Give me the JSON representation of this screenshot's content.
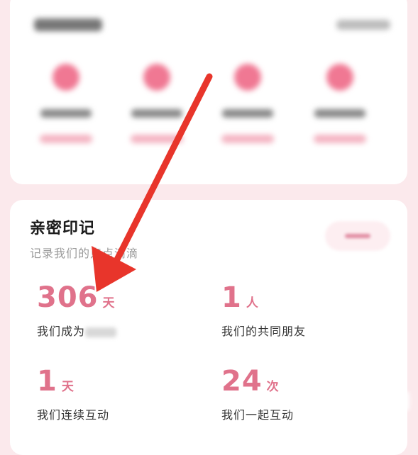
{
  "section": {
    "title": "亲密印记",
    "subtitle": "记录我们的点点滴滴"
  },
  "stats": [
    {
      "value": "306",
      "unit": "天",
      "label": "我们成为"
    },
    {
      "value": "1",
      "unit": "人",
      "label": "我们的共同朋友"
    },
    {
      "value": "1",
      "unit": "天",
      "label": "我们连续互动"
    },
    {
      "value": "24",
      "unit": "次",
      "label": "我们一起互动"
    }
  ],
  "colors": {
    "accent": "#e0728b",
    "background": "#fbe9ec",
    "annotation_arrow": "#e8352b"
  }
}
